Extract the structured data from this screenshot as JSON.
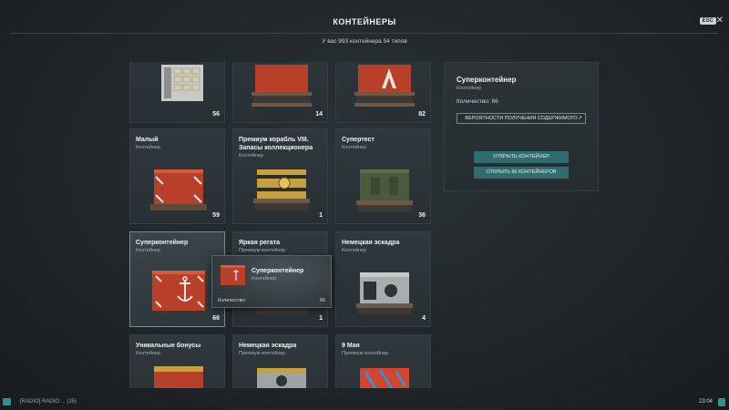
{
  "header": {
    "title": "КОНТЕЙНЕРЫ",
    "esc_label": "ESC",
    "subtitle": "У вас 993 контейнера 54 типов"
  },
  "grid": {
    "cards": [
      {
        "name": "",
        "type": "",
        "count": "56",
        "art": "grey-safe"
      },
      {
        "name": "",
        "type": "",
        "count": "14",
        "art": "red-crate"
      },
      {
        "name": "",
        "type": "",
        "count": "82",
        "art": "red-crate"
      },
      {
        "name": "Малый",
        "type": "Контейнер",
        "count": "59",
        "art": "red-crate"
      },
      {
        "name": "Премиум корабль VIII. Запасы коллекционера",
        "type": "Контейнер",
        "count": "1",
        "art": "gold-crate"
      },
      {
        "name": "Супертест",
        "type": "Контейнер",
        "count": "36",
        "art": "green-crate"
      },
      {
        "name": "Суперконтейнер",
        "type": "Контейнер",
        "count": "66",
        "art": "red-anchor"
      },
      {
        "name": "Яркая регата",
        "type": "Премиум контейнер",
        "count": "1",
        "art": "red-crate"
      },
      {
        "name": "Немецкая эскадра",
        "type": "Контейнер",
        "count": "4",
        "art": "grey-crate"
      },
      {
        "name": "Уникальные бонусы",
        "type": "Контейнер",
        "count": "",
        "art": "gold-crate"
      },
      {
        "name": "Немецкая эскадра",
        "type": "Премиум контейнер",
        "count": "",
        "art": "grey-crate"
      },
      {
        "name": "9 Мая",
        "type": "Премиум контейнер",
        "count": "",
        "art": "red-crate"
      }
    ]
  },
  "details": {
    "name": "Суперконтейнер",
    "type": "Контейнер",
    "quantity": "Количество: 66",
    "probability_button": "ВЕРОЯТНОСТИ ПОЛУЧЕНИЯ СОДЕРЖИМОГО",
    "open_button": "ОТКРЫТЬ КОНТЕЙНЕР",
    "open_all_button": "ОТКРЫТЬ 66 КОНТЕЙНЕРОВ"
  },
  "tooltip": {
    "name": "Суперконтейнер",
    "type": "Контейнер",
    "quantity_label": "Количество:",
    "quantity_value": "66"
  },
  "bottombar": {
    "chat_text": "[RADIO] RADIO ... (25)",
    "clock": "23:04"
  },
  "colors": {
    "accent": "#2f6d70",
    "crate_red": "#b8402b",
    "crate_gold": "#c7a040",
    "crate_green": "#4a5a3d"
  }
}
